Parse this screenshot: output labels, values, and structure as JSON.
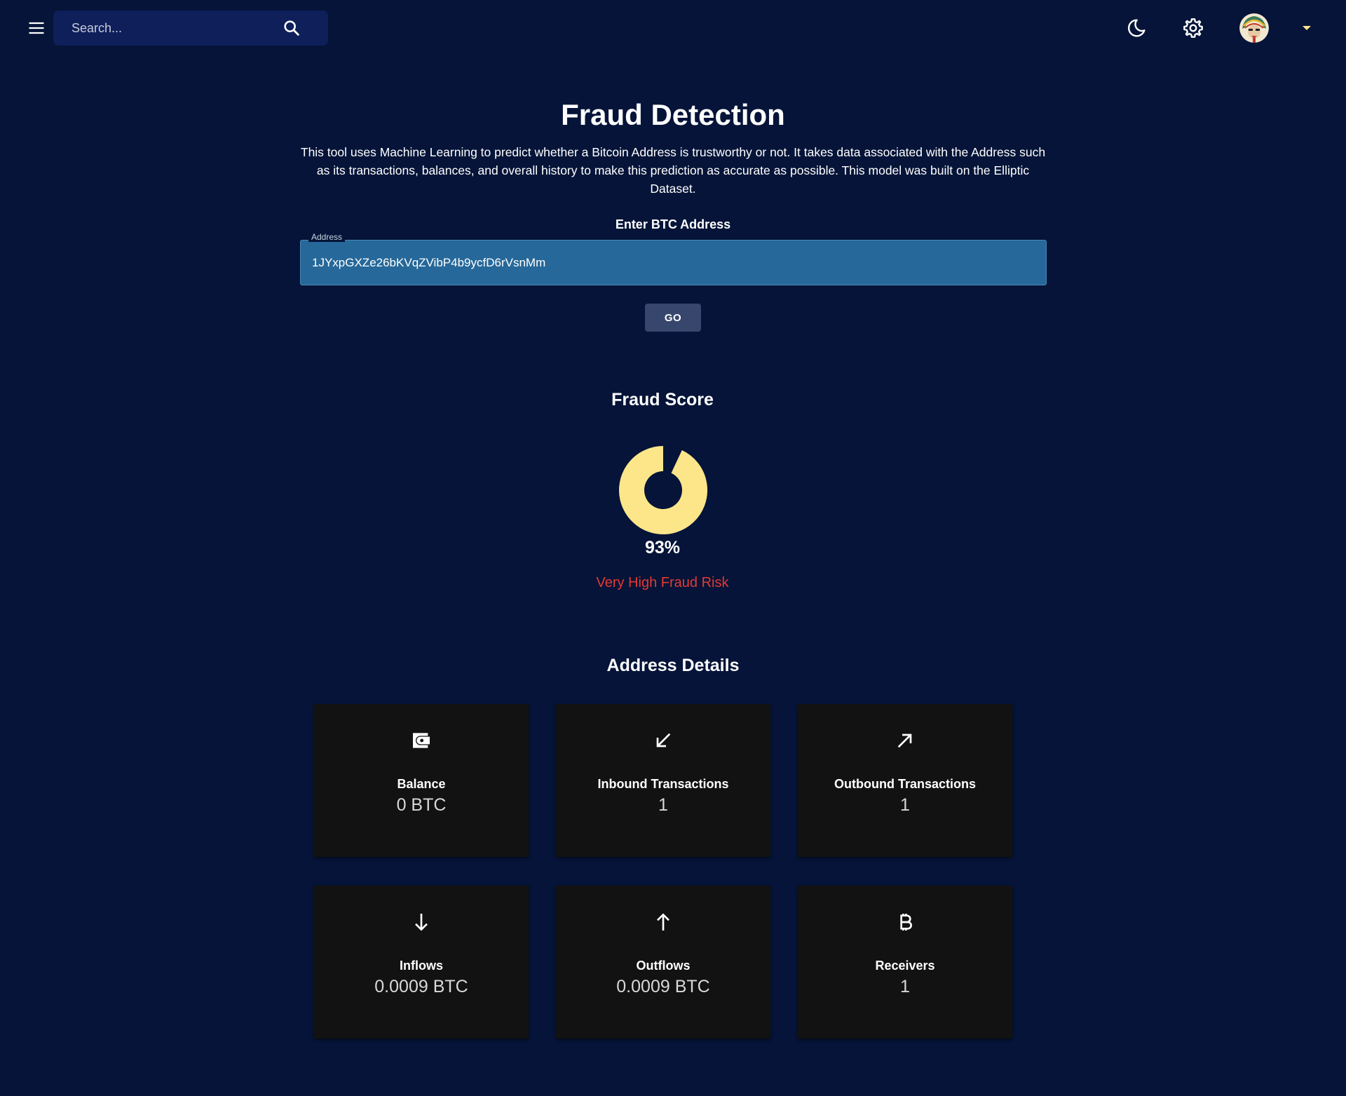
{
  "topbar": {
    "search_placeholder": "Search...",
    "icons": [
      "menu-icon",
      "search-icon",
      "moon-icon",
      "gear-icon",
      "avatar",
      "caret-down-icon"
    ]
  },
  "main": {
    "title": "Fraud Detection",
    "description": "This tool uses Machine Learning to predict whether a Bitcoin Address is trustworthy or not. It takes data associated with the Address such as its transactions, balances, and overall history to make this prediction as accurate as possible. This model was built on the Elliptic Dataset.",
    "enter_label": "Enter BTC Address",
    "address_legend": "Address",
    "address_value": "1JYxpGXZe26bKVqZVibP4b9ycfD6rVsnMm",
    "go_label": "GO"
  },
  "fraud_score": {
    "title": "Fraud Score",
    "value_text": "93%",
    "fraction": 0.93,
    "risk_label": "Very High Fraud Risk",
    "gauge_color": "#fde68a",
    "risk_color": "#e53935"
  },
  "address_details": {
    "title": "Address Details",
    "cards": [
      {
        "icon": "wallet-icon",
        "label": "Balance",
        "value": "0 BTC"
      },
      {
        "icon": "arrow-down-left-icon",
        "label": "Inbound Transactions",
        "value": "1"
      },
      {
        "icon": "arrow-up-right-icon",
        "label": "Outbound Transactions",
        "value": "1"
      },
      {
        "icon": "arrow-down-icon",
        "label": "Inflows",
        "value": "0.0009 BTC"
      },
      {
        "icon": "arrow-up-icon",
        "label": "Outflows",
        "value": "0.0009 BTC"
      },
      {
        "icon": "bitcoin-icon",
        "label": "Receivers",
        "value": "1"
      }
    ]
  },
  "colors": {
    "background": "#051438",
    "search_bg": "#0e1f5a",
    "input_bg": "#266899",
    "button_bg": "#36466d",
    "card_bg": "#121212",
    "accent": "#fde68a"
  }
}
